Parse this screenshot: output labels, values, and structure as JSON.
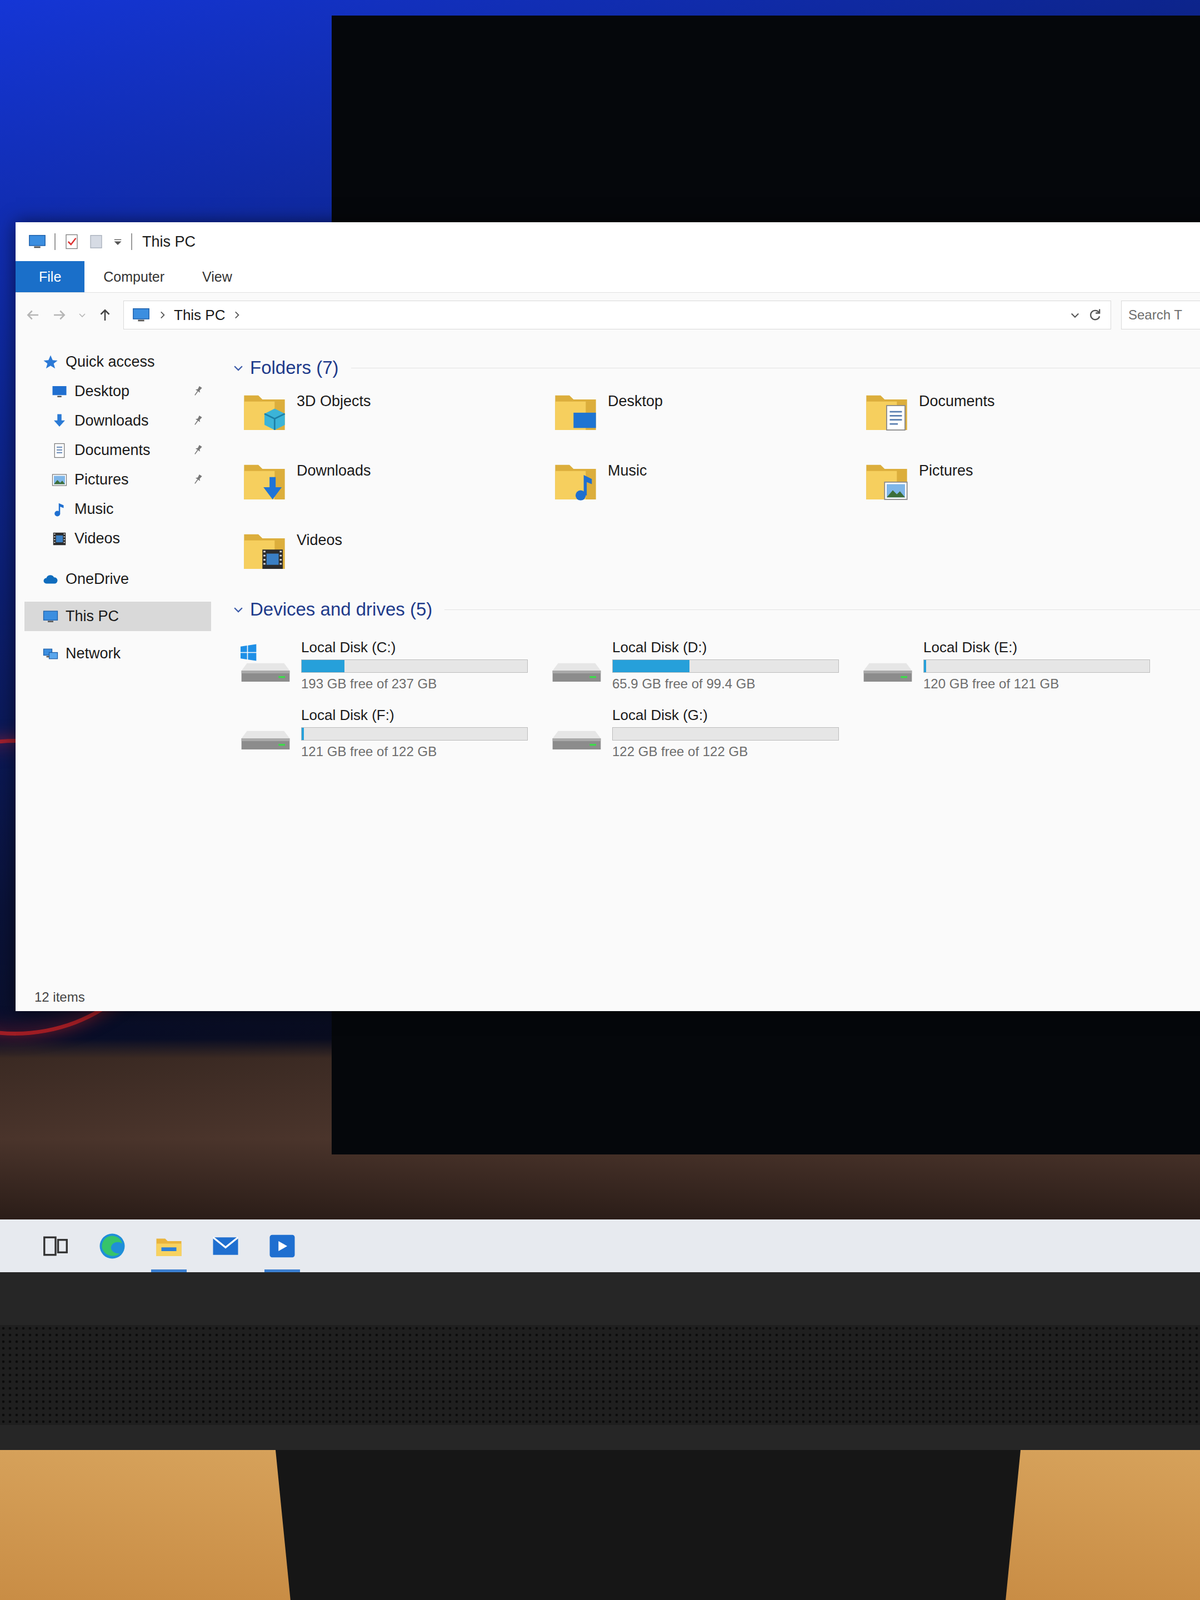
{
  "window": {
    "title": "This PC"
  },
  "ribbon": {
    "tabs": [
      {
        "label": "File",
        "selected": true
      },
      {
        "label": "Computer",
        "selected": false
      },
      {
        "label": "View",
        "selected": false
      }
    ]
  },
  "address": {
    "crumbs": [
      "This PC"
    ]
  },
  "search": {
    "placeholder": "Search T"
  },
  "sidebar": {
    "items": [
      {
        "label": "Quick access",
        "kind": "quick-access",
        "pinned": false,
        "selected": false
      },
      {
        "label": "Desktop",
        "kind": "desktop",
        "pinned": true,
        "selected": false
      },
      {
        "label": "Downloads",
        "kind": "downloads",
        "pinned": true,
        "selected": false
      },
      {
        "label": "Documents",
        "kind": "documents",
        "pinned": true,
        "selected": false
      },
      {
        "label": "Pictures",
        "kind": "pictures",
        "pinned": true,
        "selected": false
      },
      {
        "label": "Music",
        "kind": "music",
        "pinned": false,
        "selected": false
      },
      {
        "label": "Videos",
        "kind": "videos",
        "pinned": false,
        "selected": false
      },
      {
        "label": "OneDrive",
        "kind": "onedrive",
        "pinned": false,
        "selected": false
      },
      {
        "label": "This PC",
        "kind": "this-pc",
        "pinned": false,
        "selected": true
      },
      {
        "label": "Network",
        "kind": "network",
        "pinned": false,
        "selected": false
      }
    ]
  },
  "folders": {
    "heading": "Folders (7)",
    "expanded": true,
    "items": [
      {
        "label": "3D Objects",
        "kind": "3d-objects"
      },
      {
        "label": "Desktop",
        "kind": "desktop"
      },
      {
        "label": "Documents",
        "kind": "documents"
      },
      {
        "label": "Downloads",
        "kind": "downloads"
      },
      {
        "label": "Music",
        "kind": "music"
      },
      {
        "label": "Pictures",
        "kind": "pictures"
      },
      {
        "label": "Videos",
        "kind": "videos"
      }
    ]
  },
  "drives": {
    "heading": "Devices and drives (5)",
    "expanded": true,
    "items": [
      {
        "label": "Local Disk (C:)",
        "free": "193 GB free of 237 GB",
        "level": 0.19,
        "kind": "system"
      },
      {
        "label": "Local Disk (D:)",
        "free": "65.9 GB free of 99.4 GB",
        "level": 0.34,
        "kind": "data"
      },
      {
        "label": "Local Disk (E:)",
        "free": "120 GB free of 121 GB",
        "level": 0.01,
        "kind": "data"
      },
      {
        "label": "Local Disk (F:)",
        "free": "121 GB free of 122 GB",
        "level": 0.01,
        "kind": "data"
      },
      {
        "label": "Local Disk (G:)",
        "free": "122 GB free of 122 GB",
        "level": 0.0,
        "kind": "data"
      }
    ]
  },
  "status_bar": {
    "text": "12 items"
  },
  "taskbar": {
    "items": [
      {
        "kind": "task-view",
        "active": false
      },
      {
        "kind": "edge",
        "active": false
      },
      {
        "kind": "explorer",
        "active": true
      },
      {
        "kind": "mail",
        "active": false
      },
      {
        "kind": "media",
        "active": true
      }
    ]
  }
}
